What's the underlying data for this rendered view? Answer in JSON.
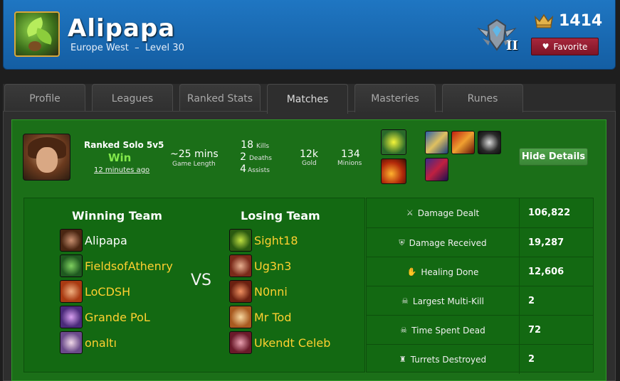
{
  "header": {
    "player_name": "Alipapa",
    "region": "Europe West",
    "separator": "–",
    "level": "Level 30",
    "tier_division": "II",
    "league_points": "1414",
    "favorite_label": "Favorite"
  },
  "tabs": [
    {
      "label": "Profile"
    },
    {
      "label": "Leagues"
    },
    {
      "label": "Ranked Stats"
    },
    {
      "label": "Matches"
    },
    {
      "label": "Masteries"
    },
    {
      "label": "Runes"
    }
  ],
  "match": {
    "queue": "Ranked Solo 5v5",
    "result": "Win",
    "time_ago": "12 minutes ago",
    "game_length": "~25 mins",
    "game_length_label": "Game Length",
    "kills": "18",
    "kills_label": "Kills",
    "deaths": "2",
    "deaths_label": "Deaths",
    "assists": "4",
    "assists_label": "Assists",
    "gold": "12k",
    "gold_label": "Gold",
    "minions": "134",
    "minions_label": "Minions",
    "hide_details_label": "Hide Details",
    "vs_label": "VS"
  },
  "winning_team": {
    "title": "Winning Team",
    "players": [
      "Alipapa",
      "FieldsofAthenry",
      "LoCDSH",
      "Grande PoL",
      "onaltı"
    ]
  },
  "losing_team": {
    "title": "Losing Team",
    "players": [
      "Sight18",
      "Ug3n3",
      "N0nni",
      "Mr Tod",
      "Ukendt Celeb"
    ]
  },
  "stats": [
    {
      "label": "Damage Dealt",
      "value": "106,822",
      "icon": "sword-icon"
    },
    {
      "label": "Damage Received",
      "value": "19,287",
      "icon": "shield-icon"
    },
    {
      "label": "Healing Done",
      "value": "12,606",
      "icon": "hand-icon"
    },
    {
      "label": "Largest Multi-Kill",
      "value": "2",
      "icon": "skulls-icon"
    },
    {
      "label": "Time Spent Dead",
      "value": "72",
      "icon": "skull-icon"
    },
    {
      "label": "Turrets Destroyed",
      "value": "2",
      "icon": "turret-icon"
    }
  ],
  "colors": {
    "header_blue": "#1f76c2",
    "match_green": "#1b6f18",
    "win_text": "#82e84b",
    "ally_name": "#ffffff",
    "other_name": "#ffd030",
    "favorite_red": "#a7273c"
  }
}
